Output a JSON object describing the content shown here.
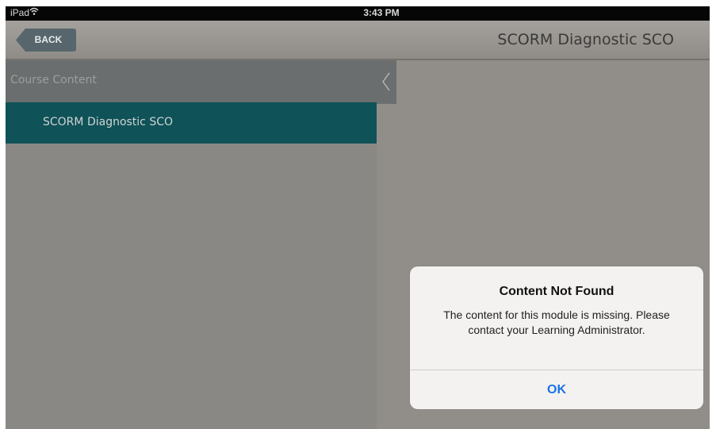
{
  "status_bar": {
    "device": "iPad",
    "time": "3:43 PM"
  },
  "nav": {
    "back_label": "BACK",
    "title": "SCORM Diagnostic SCO"
  },
  "sidebar": {
    "header": "Course Content",
    "items": [
      {
        "label": "SCORM Diagnostic SCO",
        "selected": true
      }
    ]
  },
  "alert": {
    "title": "Content Not Found",
    "message": "The content for this module is missing. Please contact your Learning Administrator.",
    "button": "OK"
  },
  "colors": {
    "selected_item": "#0f5258",
    "ok_button": "#1a73e8",
    "back_button": "#56666c"
  },
  "icons": {
    "wifi": "wifi-icon",
    "collapse": "chevron-left-icon"
  }
}
